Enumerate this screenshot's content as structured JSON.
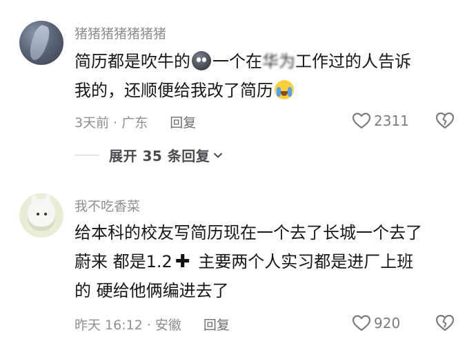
{
  "comments": [
    {
      "username": "猪猪猪猪猪猪猪",
      "text_a": "简历都是吹牛的",
      "text_b": "一个在",
      "text_blurred": "华为",
      "text_c": "工作过的人告诉",
      "text_d": "我的，还顺便给我改了简历",
      "time_location": "3天前 · 广东",
      "reply_label": "回复",
      "likes": "2311",
      "expand_label": "展开 35 条回复"
    },
    {
      "username": "我不吃香菜",
      "text_a": "给本科的校友写简历现在一个去了长城一个去了",
      "text_b": "蔚来  都是1.2",
      "text_c": "主要两个人实习都是进厂上班",
      "text_d": "的  硬给他俩编进去了",
      "time_location": "昨天 16:12 · 安徽",
      "reply_label": "回复",
      "likes": "920"
    }
  ],
  "icons": {
    "like": "heart-outline-icon",
    "dislike": "broken-heart-icon",
    "expand": "chevron-down-icon"
  }
}
